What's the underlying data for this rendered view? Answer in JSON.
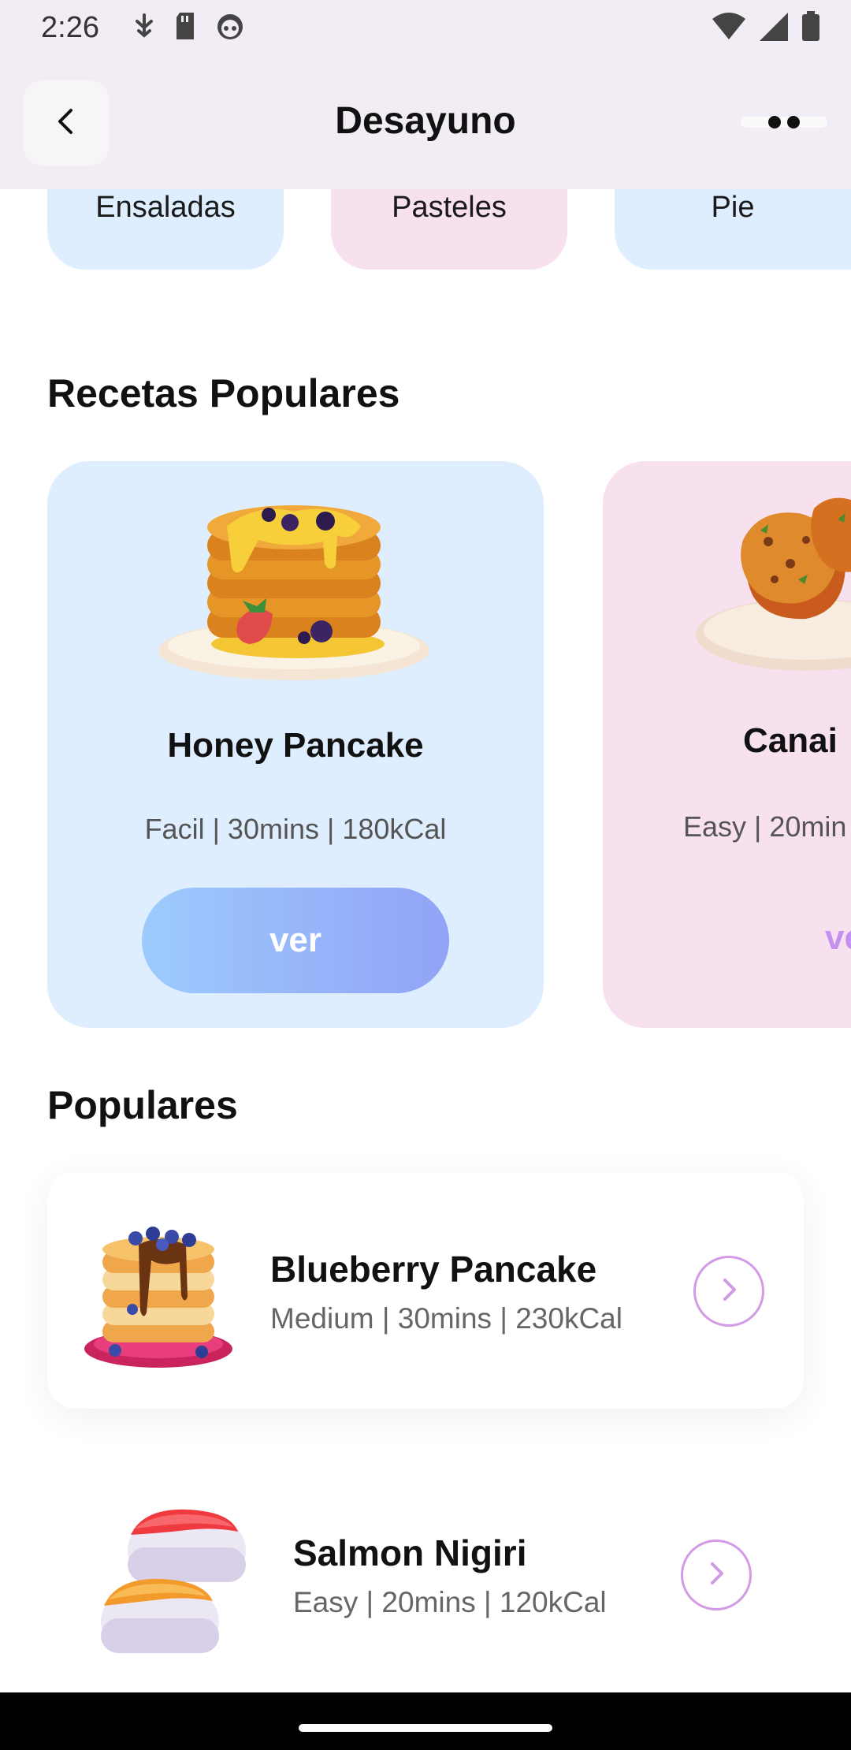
{
  "status_bar": {
    "time": "2:26",
    "left_icons": [
      "usb-debug-icon",
      "sd-card-icon",
      "android-head-icon"
    ],
    "right_icons": [
      "wifi-icon",
      "signal-icon",
      "battery-icon"
    ]
  },
  "app_bar": {
    "title": "Desayuno",
    "back_icon": "chevron-left-icon",
    "more_icon": "more-horizontal-icon"
  },
  "categories": [
    {
      "label": "Ensaladas",
      "color": "#dfeefe"
    },
    {
      "label": "Pasteles",
      "color": "#f8e1ee"
    },
    {
      "label": "Pie",
      "color": "#dfeefe"
    }
  ],
  "popular_recipes": {
    "title": "Recetas Populares",
    "cards": [
      {
        "name": "Honey Pancake",
        "meta": "Facil | 30mins | 180kCal",
        "button": "ver",
        "color": "#dfeefe",
        "image": "pancake-stack-icon"
      },
      {
        "name": "Canai",
        "meta": "Easy | 20min",
        "button": "ve",
        "color": "#f8e1ee",
        "image": "canai-bread-icon"
      }
    ]
  },
  "populares": {
    "title": "Populares",
    "items": [
      {
        "name": "Blueberry Pancake",
        "meta": "Medium | 30mins | 230kCal",
        "image": "blueberry-pancake-icon",
        "action_icon": "chevron-right-icon"
      },
      {
        "name": "Salmon Nigiri",
        "meta": "Easy | 20mins | 120kCal",
        "image": "salmon-nigiri-icon",
        "action_icon": "chevron-right-icon"
      }
    ]
  },
  "colors": {
    "app_bar_bg": "#f2ecf4",
    "accent": "#d29be4",
    "button_gradient_start": "#9dcbfd",
    "button_gradient_end": "#91a3f6"
  }
}
